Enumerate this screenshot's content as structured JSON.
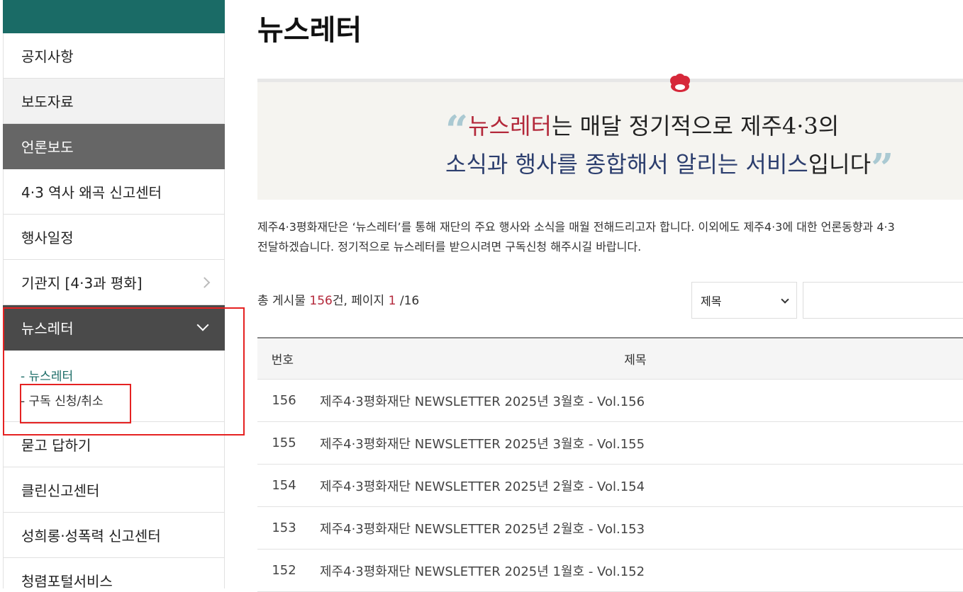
{
  "sidebar": {
    "items": [
      {
        "label": "공지사항"
      },
      {
        "label": "보도자료"
      },
      {
        "label": "언론보도"
      },
      {
        "label": "4·3 역사 왜곡 신고센터"
      },
      {
        "label": "행사일정"
      },
      {
        "label": "기관지 [4·3과 평화]"
      },
      {
        "label": "뉴스레터"
      },
      {
        "label": "묻고 답하기"
      },
      {
        "label": "클린신고센터"
      },
      {
        "label": "성희롱·성폭력 신고센터"
      },
      {
        "label": "청렴포털서비스"
      }
    ],
    "submenu": [
      {
        "label": "- 뉴스레터"
      },
      {
        "label": "- 구독 신청/취소"
      }
    ]
  },
  "page": {
    "title": "뉴스레터",
    "banner": {
      "line1_highlight": "뉴스레터",
      "line1_rest": "는 매달 정기적으로 제주4·3의",
      "line2_highlight": "소식과 행사를 종합해서 알리는 서비스",
      "line2_rest": "입니다",
      "open_quote": "“",
      "close_quote": "”"
    },
    "description_line1": "제주4·3평화재단은 ‘뉴스레터’를 통해 재단의 주요 행사와 소식을 매월 전해드리고자 합니다. 이외에도 제주4·3에 대한 언론동향과 4·3",
    "description_line2": "전달하겠습니다. 정기적으로 뉴스레터를 받으시려면 구독신청 해주시길 바랍니다."
  },
  "search": {
    "count_prefix": "총 게시물 ",
    "count_total": "156",
    "count_mid": "건, 페이지 ",
    "page_current": "1",
    "page_total": " /16",
    "select_value": "제목",
    "input_value": ""
  },
  "table": {
    "headers": {
      "no": "번호",
      "title": "제목"
    },
    "rows": [
      {
        "no": "156",
        "title": "제주4·3평화재단 NEWSLETTER 2025년 3월호 - Vol.156"
      },
      {
        "no": "155",
        "title": "제주4·3평화재단 NEWSLETTER 2025년 3월호 - Vol.155"
      },
      {
        "no": "154",
        "title": "제주4·3평화재단 NEWSLETTER 2025년 2월호 - Vol.154"
      },
      {
        "no": "153",
        "title": "제주4·3평화재단 NEWSLETTER 2025년 2월호 - Vol.153"
      },
      {
        "no": "152",
        "title": "제주4·3평화재단 NEWSLETTER 2025년 1월호 - Vol.152"
      }
    ]
  },
  "colors": {
    "brand_teal": "#1a6b66",
    "accent_red": "#b3283a",
    "navy": "#2c3e6e",
    "highlight_box": "#e52222"
  },
  "icons": {
    "banner": "flower-emblem-icon",
    "expand": "chevron-right-icon",
    "collapse": "chevron-down-icon",
    "select": "chevron-down-icon"
  }
}
